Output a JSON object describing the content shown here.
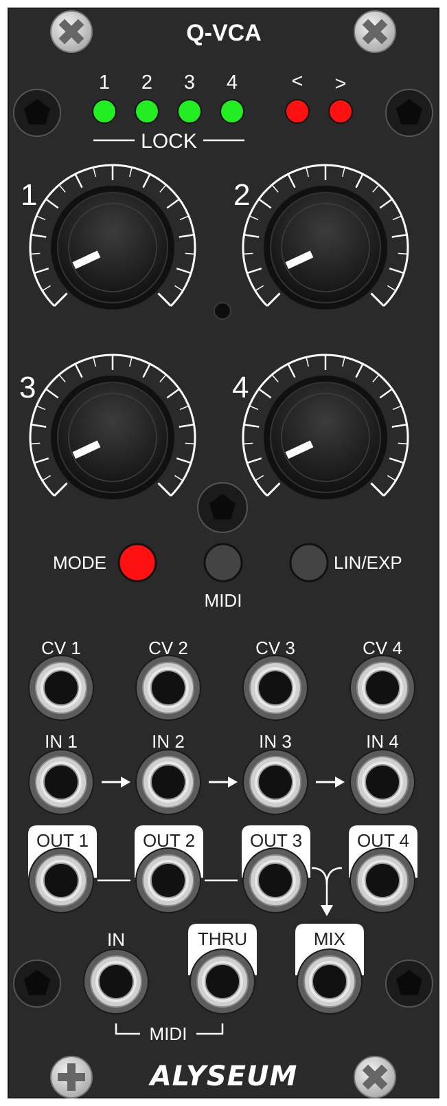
{
  "module": {
    "title": "Q-VCA",
    "brand": "ALYSEUM",
    "panel_color": "#2a2a2a"
  },
  "lock_section": {
    "channel_numbers": [
      "1",
      "2",
      "3",
      "4"
    ],
    "nav_left": "<",
    "nav_right": ">",
    "label": "LOCK",
    "channel_led_color": "#22ee22",
    "nav_led_color": "#ff1111"
  },
  "knobs": [
    {
      "label": "1",
      "level": 0.0
    },
    {
      "label": "2",
      "level": 0.0
    },
    {
      "label": "3",
      "level": 0.0
    },
    {
      "label": "4",
      "level": 0.0
    }
  ],
  "buttons": {
    "mode": {
      "label": "MODE",
      "color": "#ff1111",
      "lit": true
    },
    "midi": {
      "label": "MIDI",
      "color": "#444444",
      "lit": false
    },
    "lin_exp": {
      "label": "LIN/EXP",
      "color": "#444444",
      "lit": false
    }
  },
  "jacks": {
    "cv": [
      "CV 1",
      "CV 2",
      "CV 3",
      "CV 4"
    ],
    "inputs": [
      "IN 1",
      "IN 2",
      "IN 3",
      "IN 4"
    ],
    "outputs": [
      "OUT 1",
      "OUT 2",
      "OUT 3",
      "OUT 4"
    ],
    "midi_in": "IN",
    "midi_thru": "THRU",
    "mix": "MIX",
    "midi_group_label": "MIDI"
  },
  "icons": {
    "screw": "phillips-screw-icon",
    "mounting_hole": "mounting-hole-icon",
    "arrow": "arrow-right-icon"
  }
}
